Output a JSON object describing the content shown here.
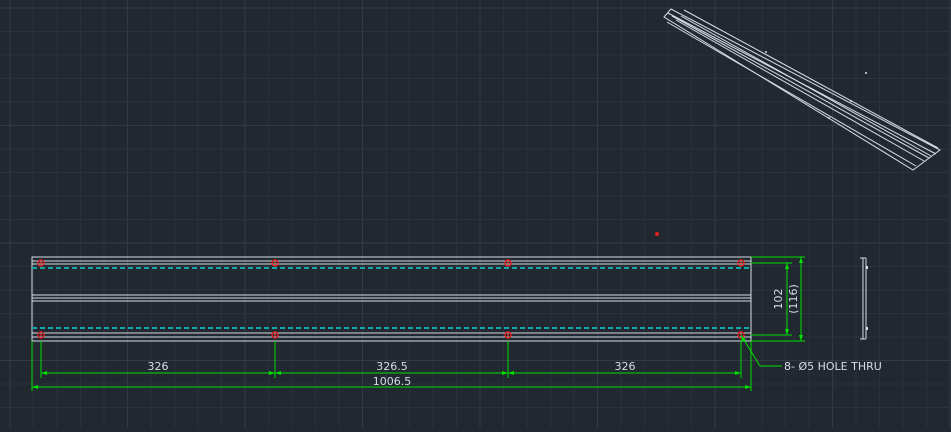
{
  "colors": {
    "background": "#212830",
    "grid_minor": "#2a323b",
    "grid_major": "#323b45",
    "outline": "#d8dde4",
    "dimension": "#00e000",
    "hidden_line": "#13a7a7",
    "hole_marker": "#e02020",
    "leader": "#00e000"
  },
  "dimensions": {
    "span_1": "326",
    "span_2": "326.5",
    "span_3": "326",
    "overall": "1006.5",
    "height_inner": "102",
    "height_outer": "(116)"
  },
  "annotation": {
    "hole_callout": "8- Ø5 HOLE THRU"
  }
}
